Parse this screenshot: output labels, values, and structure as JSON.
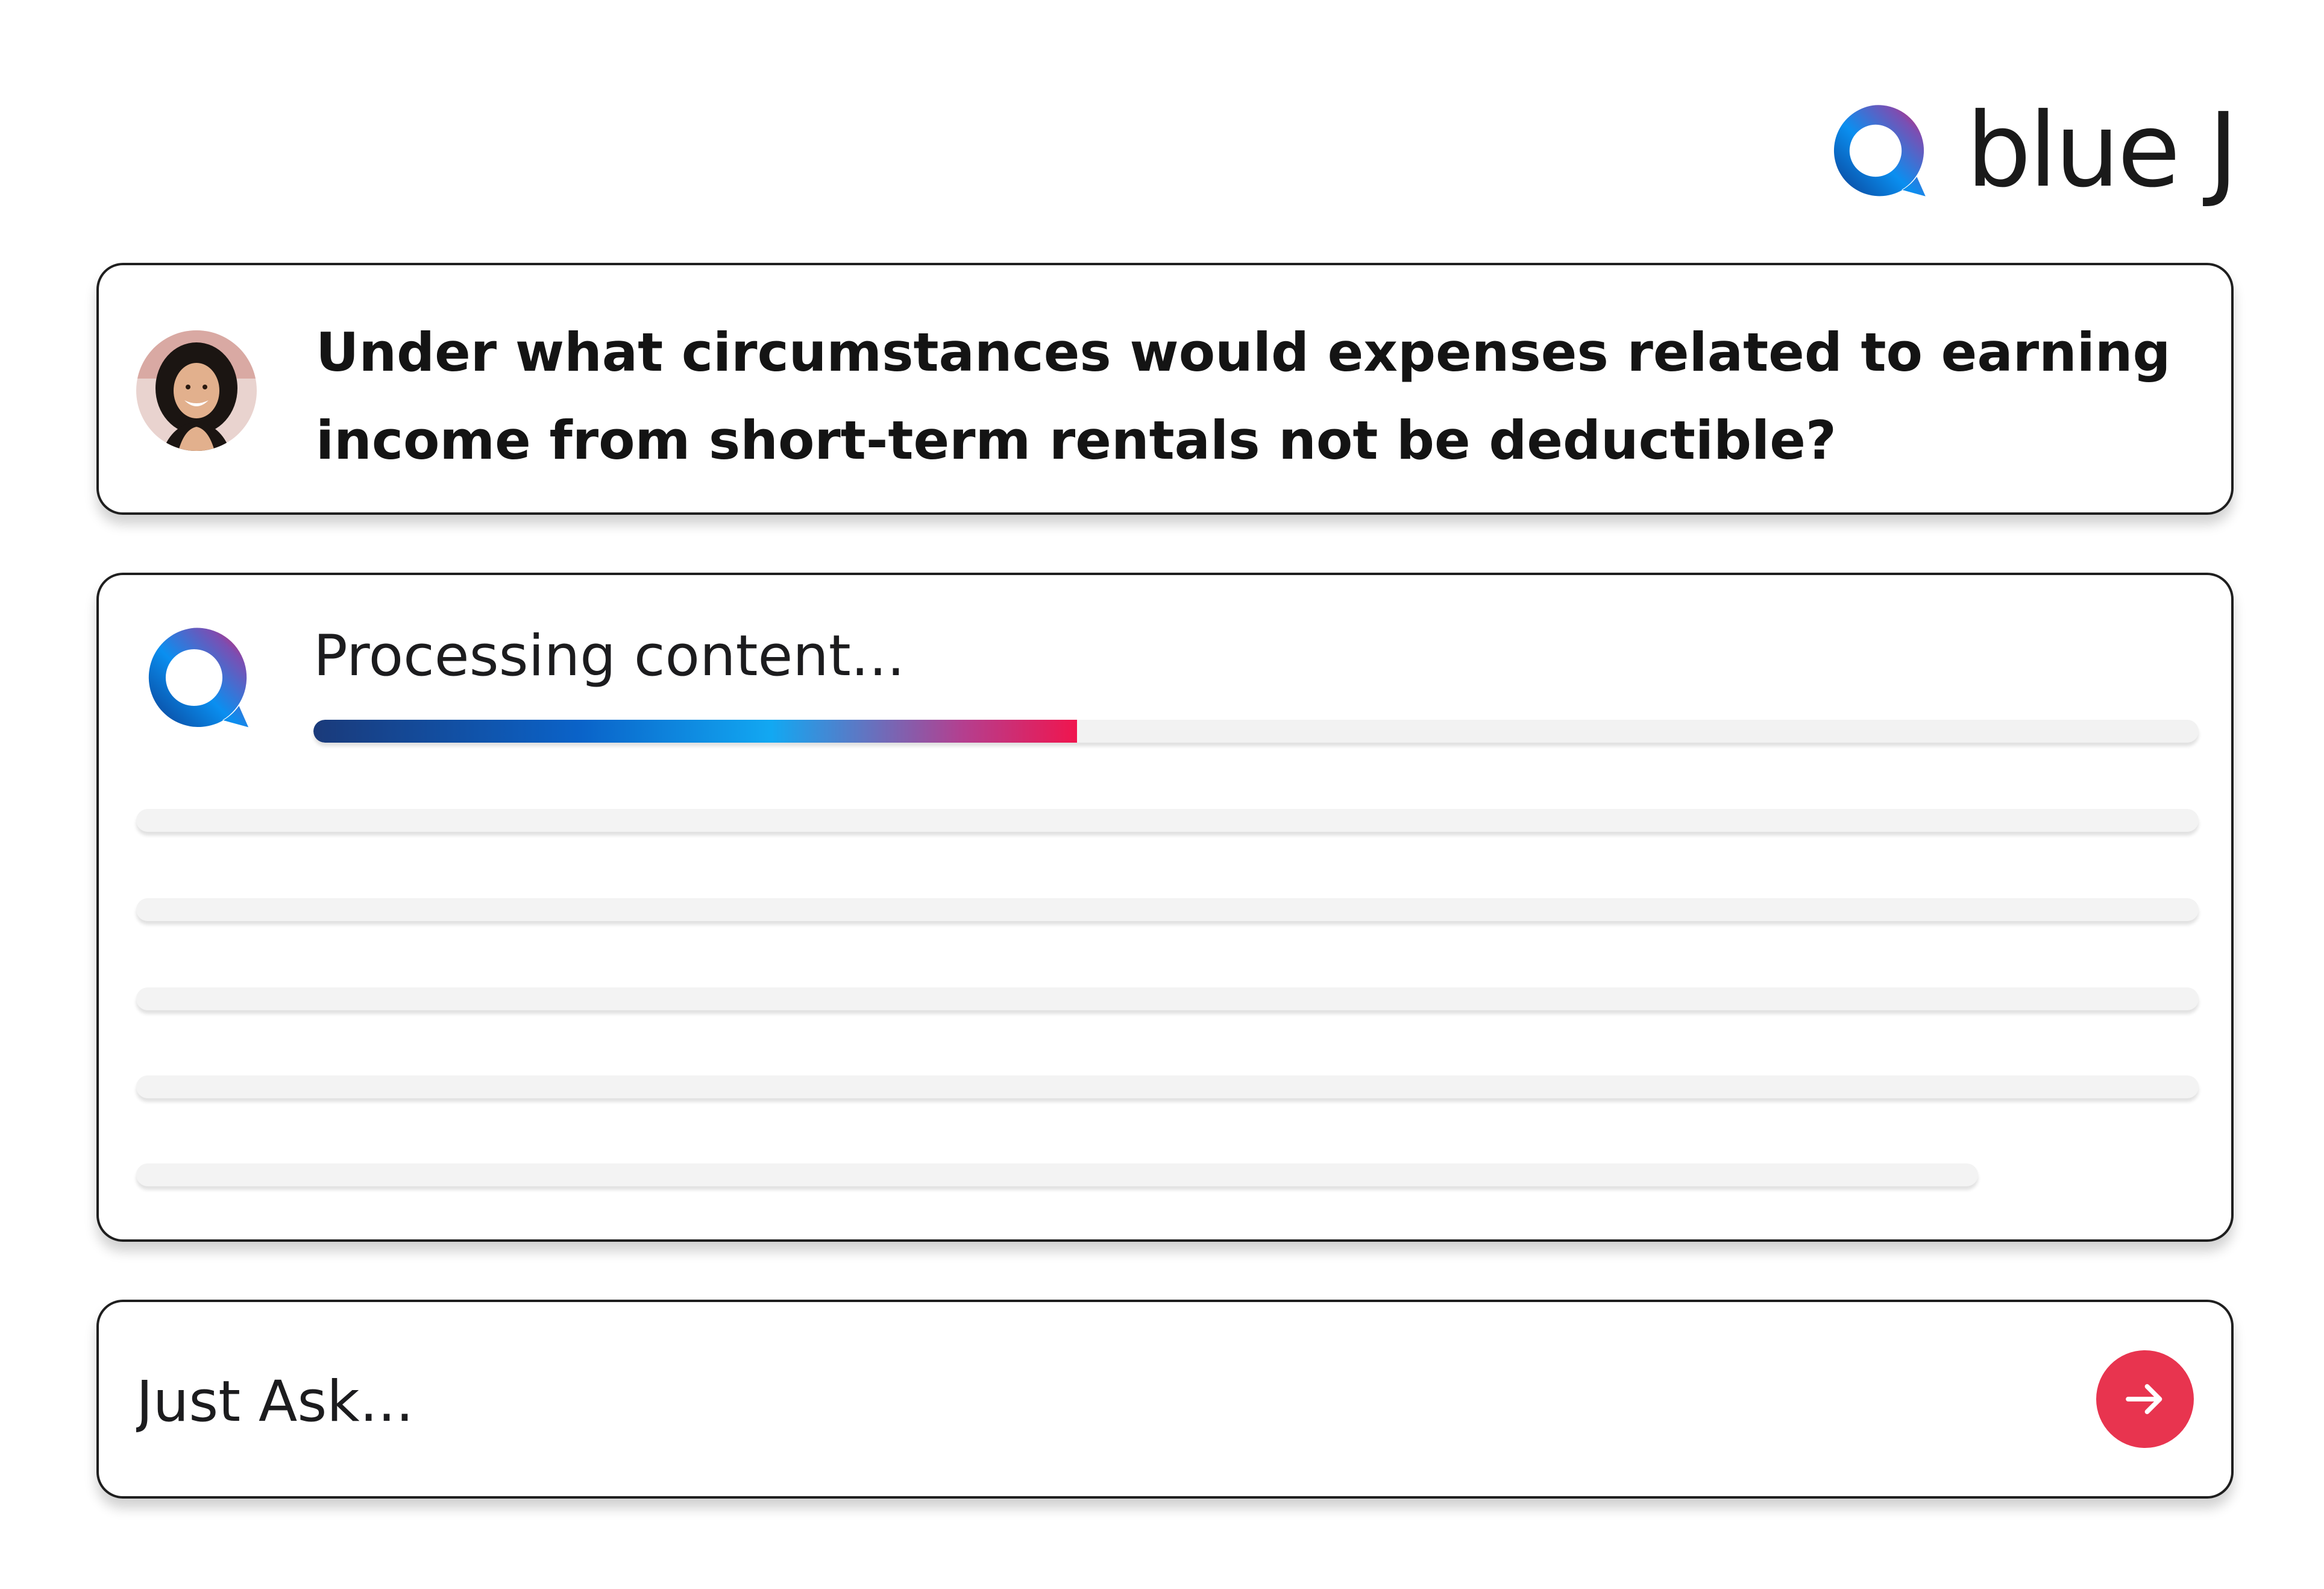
{
  "brand": {
    "wordmark": "blue J",
    "logo_icon": "bluej-chat-bubble-icon"
  },
  "question": {
    "avatar_icon": "user-avatar",
    "text": "Under what circumstances would expenses related to earning income from short-term rentals not be deductible?"
  },
  "processing": {
    "bot_icon": "bluej-chat-bubble-icon",
    "label": "Processing content...",
    "progress_fraction": 0.405,
    "skeleton_line_count": 5
  },
  "ask": {
    "placeholder": "Just Ask...",
    "send_icon": "arrow-right-icon"
  },
  "colors": {
    "send_button": "#e8344f",
    "gradient_start": "#1a3a7a",
    "gradient_mid": "#12a8f2",
    "gradient_end": "#f0154e",
    "card_border": "#1f1f1f"
  }
}
